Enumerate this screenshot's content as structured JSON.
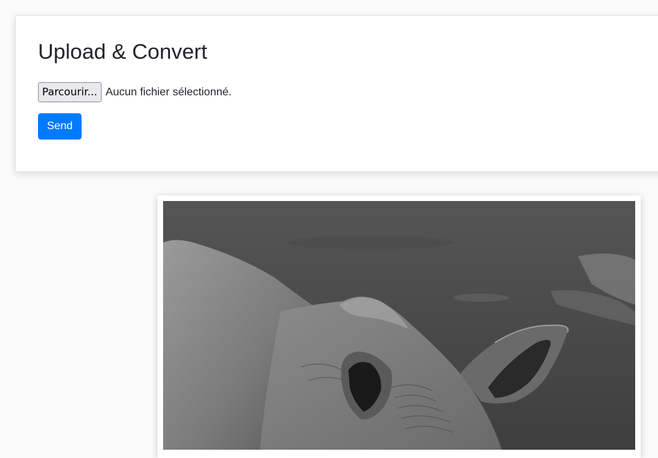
{
  "upload": {
    "title": "Upload & Convert",
    "file_button_label": "Parcourir...",
    "file_status": "Aucun fichier sélectionné.",
    "send_label": "Send"
  },
  "colors": {
    "primary": "#007bff",
    "page_background": "#fafafa"
  }
}
